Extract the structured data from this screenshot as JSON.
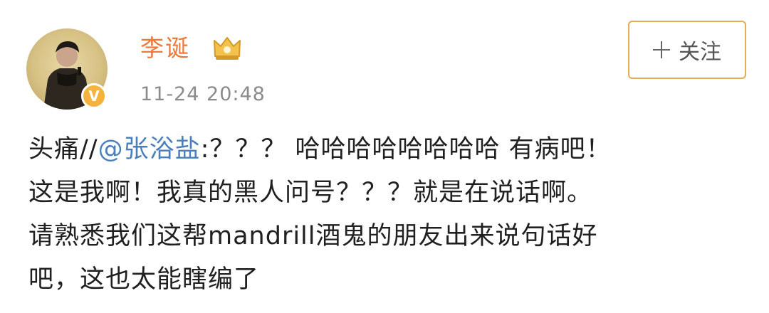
{
  "post": {
    "author": {
      "name": "李诞",
      "avatar_icon": "avatar-portrait",
      "verified_icon": "verified-v-icon",
      "verified_mark": "V",
      "badge_icon": "crown-icon"
    },
    "timestamp": "11-24 20:48",
    "follow_button": {
      "icon": "plus-icon",
      "label": "关注"
    },
    "text": {
      "line1_prefix": "头痛//",
      "mention": "@张浴盐",
      "line1_suffix": ":？？？ 哈哈哈哈哈哈哈哈 有病吧！",
      "line2": "这是我啊！我真的黑人问号？？？就是在说话啊。",
      "line3": "请熟悉我们这帮mandrill酒鬼的朋友出来说句话好",
      "line4": "吧，这也太能瞎编了"
    }
  },
  "colors": {
    "username": "#eb7a3a",
    "mention": "#4a7fbe",
    "follow_border": "#e2ac58",
    "timestamp": "#8b8b8b",
    "verified": "#f5b23c"
  }
}
